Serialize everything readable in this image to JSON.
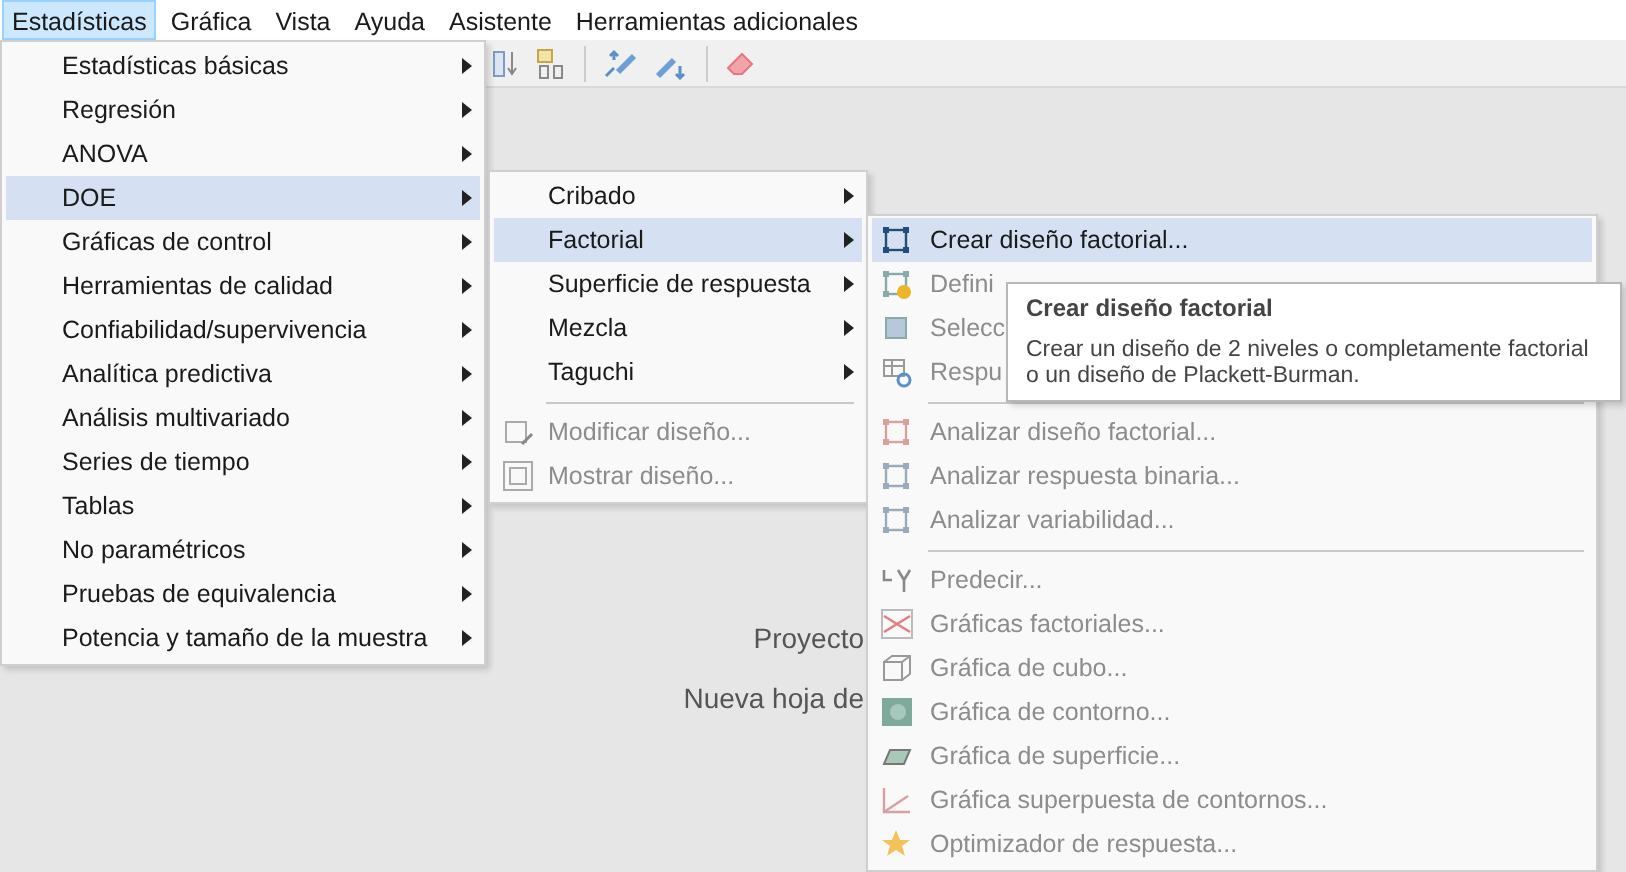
{
  "menubar": [
    {
      "label": "Estadísticas",
      "selected": true
    },
    {
      "label": "Gráfica",
      "selected": false
    },
    {
      "label": "Vista",
      "selected": false
    },
    {
      "label": "Ayuda",
      "selected": false
    },
    {
      "label": "Asistente",
      "selected": false
    },
    {
      "label": "Herramientas adicionales",
      "selected": false
    }
  ],
  "workspace": {
    "project_label": "Proyecto",
    "worksheet_label": "Nueva hoja de"
  },
  "stats_menu": [
    {
      "label": "Estadísticas básicas",
      "selected": false,
      "has_submenu": true
    },
    {
      "label": "Regresión",
      "selected": false,
      "has_submenu": true
    },
    {
      "label": "ANOVA",
      "selected": false,
      "has_submenu": true
    },
    {
      "label": "DOE",
      "selected": true,
      "has_submenu": true
    },
    {
      "label": "Gráficas de control",
      "selected": false,
      "has_submenu": true
    },
    {
      "label": "Herramientas de calidad",
      "selected": false,
      "has_submenu": true
    },
    {
      "label": "Confiabilidad/supervivencia",
      "selected": false,
      "has_submenu": true
    },
    {
      "label": "Analítica predictiva",
      "selected": false,
      "has_submenu": true
    },
    {
      "label": "Análisis multivariado",
      "selected": false,
      "has_submenu": true
    },
    {
      "label": "Series de tiempo",
      "selected": false,
      "has_submenu": true
    },
    {
      "label": "Tablas",
      "selected": false,
      "has_submenu": true
    },
    {
      "label": "No paramétricos",
      "selected": false,
      "has_submenu": true
    },
    {
      "label": "Pruebas de equivalencia",
      "selected": false,
      "has_submenu": true
    },
    {
      "label": "Potencia y tamaño de la muestra",
      "selected": false,
      "has_submenu": true
    }
  ],
  "doe_menu": [
    {
      "kind": "item",
      "label": "Cribado",
      "selected": false,
      "disabled": false,
      "has_submenu": true
    },
    {
      "kind": "item",
      "label": "Factorial",
      "selected": true,
      "disabled": false,
      "has_submenu": true
    },
    {
      "kind": "item",
      "label": "Superficie de respuesta",
      "selected": false,
      "disabled": false,
      "has_submenu": true
    },
    {
      "kind": "item",
      "label": "Mezcla",
      "selected": false,
      "disabled": false,
      "has_submenu": true
    },
    {
      "kind": "item",
      "label": "Taguchi",
      "selected": false,
      "disabled": false,
      "has_submenu": true
    },
    {
      "kind": "separator"
    },
    {
      "kind": "item",
      "label": "Modificar diseño...",
      "selected": false,
      "disabled": true,
      "has_submenu": false
    },
    {
      "kind": "item",
      "label": "Mostrar diseño...",
      "selected": false,
      "disabled": true,
      "has_submenu": false
    }
  ],
  "factorial_menu": [
    {
      "kind": "item",
      "label": "Crear diseño factorial...",
      "selected": true,
      "disabled": false
    },
    {
      "kind": "item",
      "label": "Defini",
      "selected": false,
      "disabled": true
    },
    {
      "kind": "item",
      "label": "Selecc",
      "selected": false,
      "disabled": true
    },
    {
      "kind": "item",
      "label": "Respu",
      "selected": false,
      "disabled": true
    },
    {
      "kind": "separator"
    },
    {
      "kind": "item",
      "label": "Analizar diseño factorial...",
      "selected": false,
      "disabled": true
    },
    {
      "kind": "item",
      "label": "Analizar respuesta binaria...",
      "selected": false,
      "disabled": true
    },
    {
      "kind": "item",
      "label": "Analizar variabilidad...",
      "selected": false,
      "disabled": true
    },
    {
      "kind": "separator"
    },
    {
      "kind": "item",
      "label": "Predecir...",
      "selected": false,
      "disabled": true
    },
    {
      "kind": "item",
      "label": "Gráficas factoriales...",
      "selected": false,
      "disabled": true
    },
    {
      "kind": "item",
      "label": "Gráfica de cubo...",
      "selected": false,
      "disabled": true
    },
    {
      "kind": "item",
      "label": "Gráfica de contorno...",
      "selected": false,
      "disabled": true
    },
    {
      "kind": "item",
      "label": "Gráfica de superficie...",
      "selected": false,
      "disabled": true
    },
    {
      "kind": "item",
      "label": "Gráfica superpuesta de contornos...",
      "selected": false,
      "disabled": true
    },
    {
      "kind": "item",
      "label": "Optimizador de respuesta...",
      "selected": false,
      "disabled": true
    }
  ],
  "tooltip": {
    "title": "Crear diseño factorial",
    "text": "Crear un diseño de 2 niveles o completamente factorial o un diseño de Plackett-Burman."
  }
}
